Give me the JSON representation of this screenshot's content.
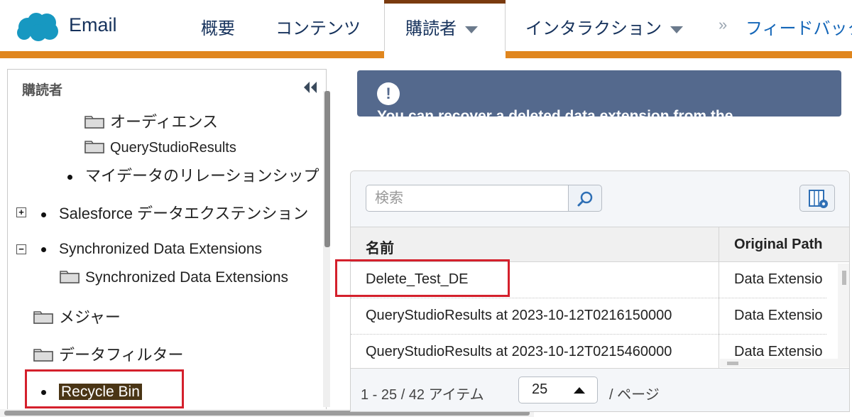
{
  "header": {
    "app_name": "Email",
    "nav": [
      {
        "label": "概要"
      },
      {
        "label": "コンテンツ"
      },
      {
        "label": "購読者"
      },
      {
        "label": "インタラクション"
      },
      {
        "label": "フィードバック"
      }
    ],
    "more_label": "»",
    "colors": {
      "accent": "#e0861e",
      "active_tab_top": "#7a3b0f",
      "logo": "#1798c1"
    }
  },
  "tree": {
    "title": "購読者",
    "items": [
      {
        "label": "オーディエンス"
      },
      {
        "label": "QueryStudioResults"
      },
      {
        "label": "マイデータのリレーションシップ"
      },
      {
        "label": "Salesforce データエクステンション"
      },
      {
        "label": "Synchronized Data Extensions"
      },
      {
        "label": "Synchronized Data Extensions"
      },
      {
        "label": "メジャー"
      },
      {
        "label": "データフィルター"
      },
      {
        "label": "Recycle Bin"
      }
    ],
    "toggles": {
      "expand": "+",
      "collapse": "−"
    }
  },
  "alert": {
    "icon": "!",
    "text": "You can recover a deleted data extension from the"
  },
  "list": {
    "search_placeholder": "検索",
    "columns": {
      "name": "名前",
      "path": "Original Path"
    },
    "rows": [
      {
        "name": "Delete_Test_DE",
        "path": "Data Extensio"
      },
      {
        "name": "QueryStudioResults at 2023-10-12T0216150000",
        "path": "Data Extensio"
      },
      {
        "name": "QueryStudioResults at 2023-10-12T0215460000",
        "path": "Data Extensio"
      }
    ],
    "pager": {
      "summary": "1 - 25 / 42 アイテム",
      "page_size": "25",
      "per_page": "/ ページ"
    }
  }
}
